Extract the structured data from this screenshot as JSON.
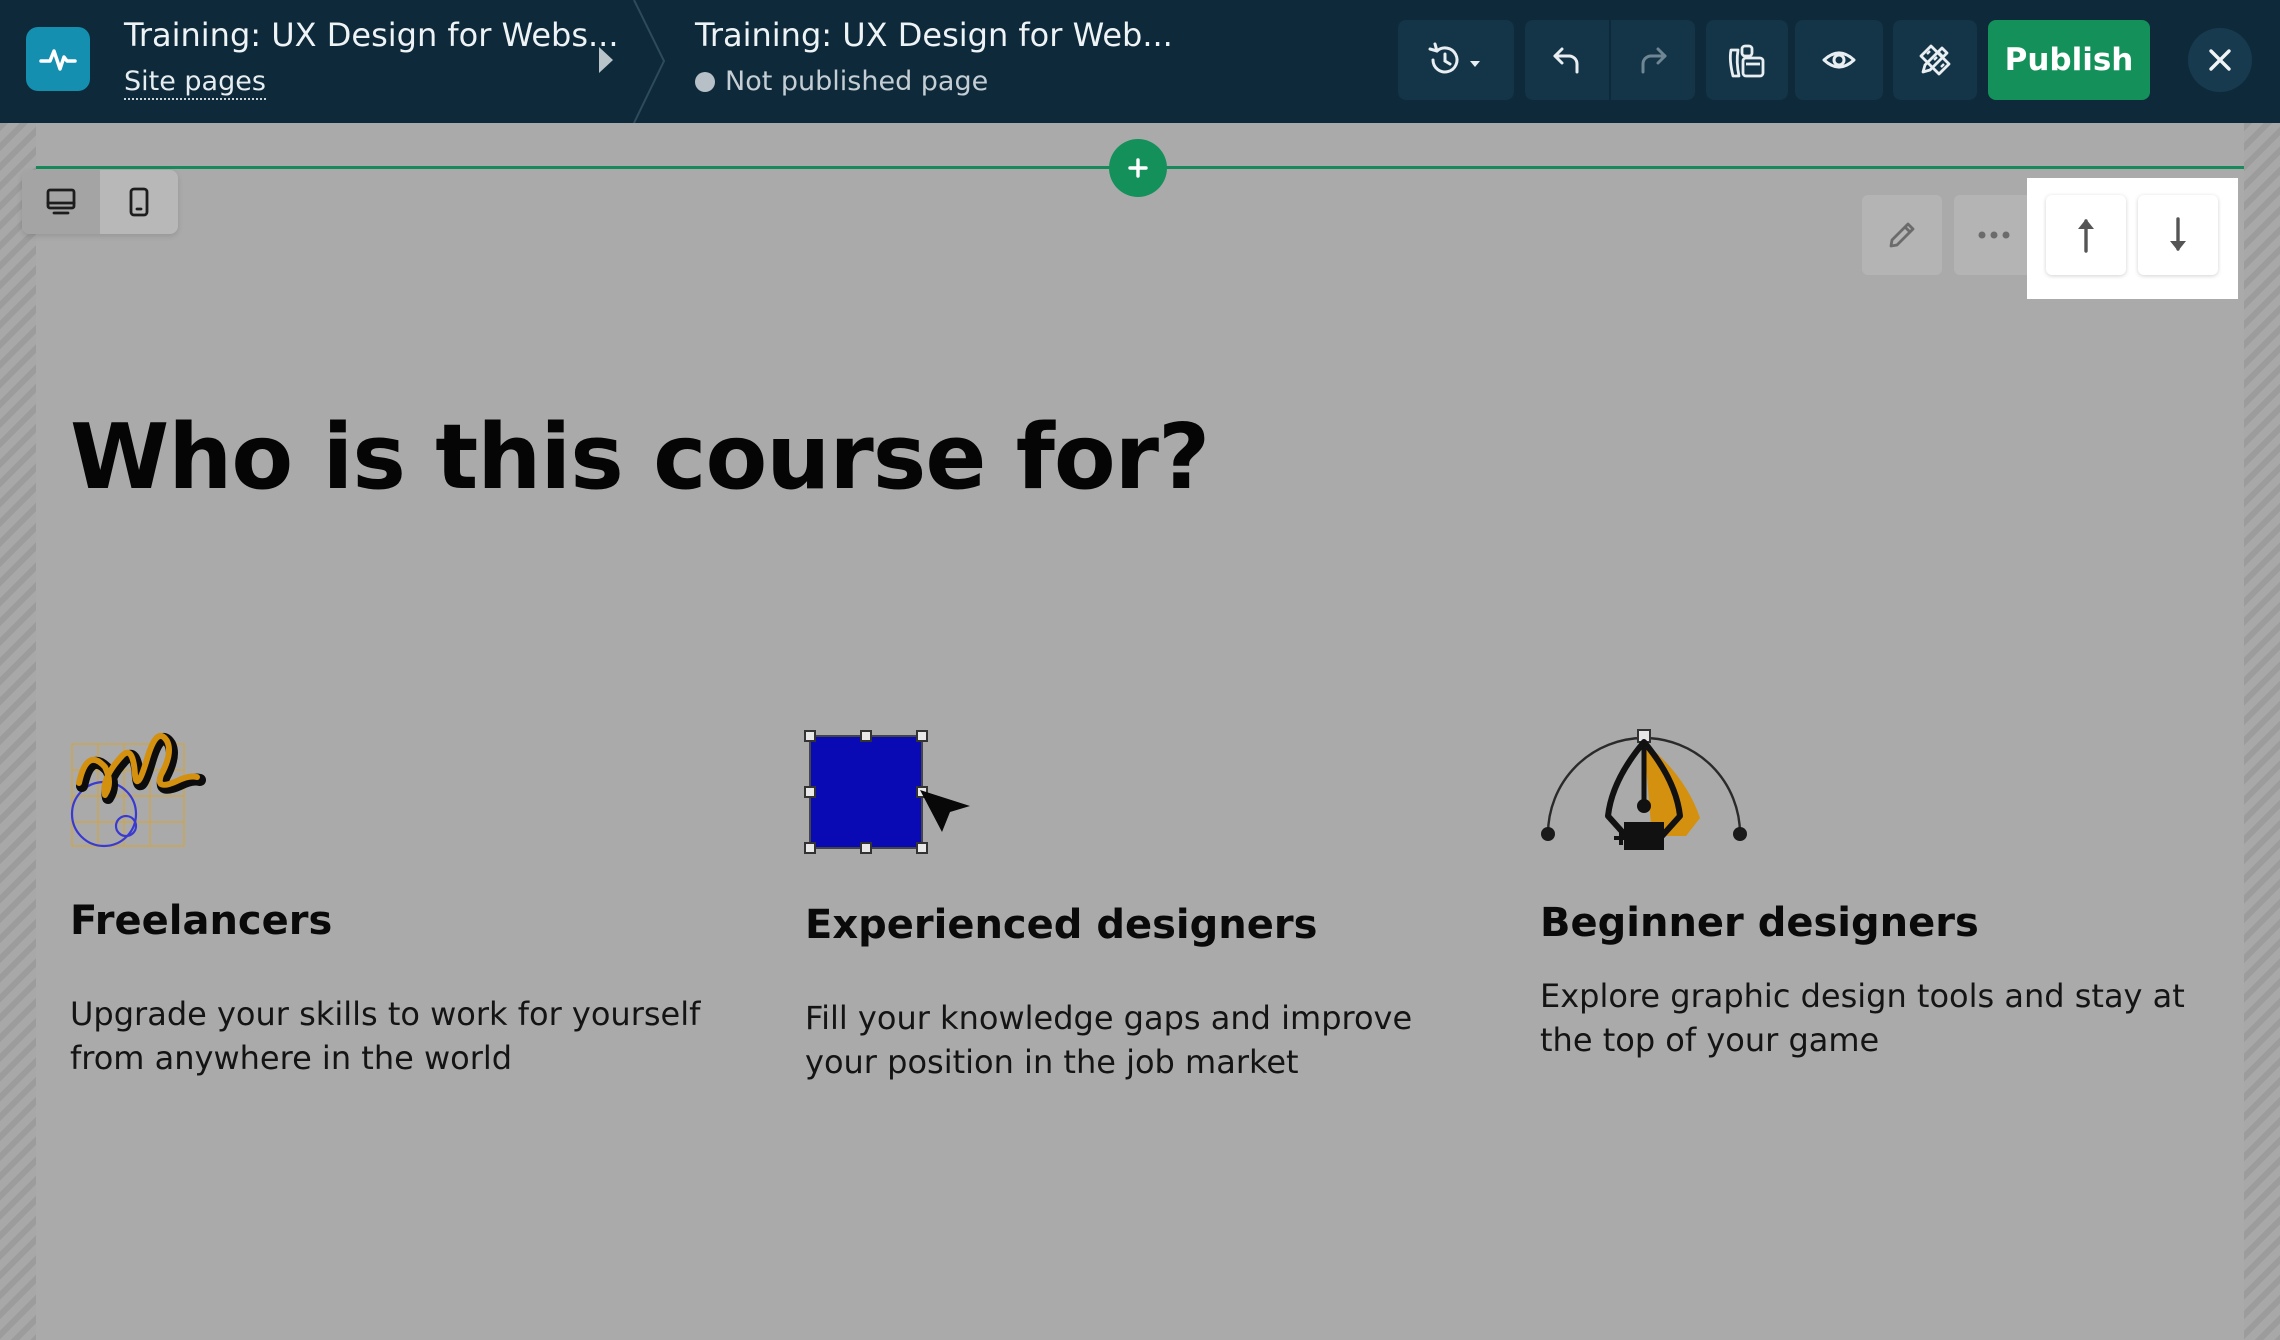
{
  "topbar": {
    "site_title": "Training: UX Design for Webs...",
    "site_pages_label": "Site pages",
    "page_title": "Training: UX Design for Web...",
    "page_status": "Not published page",
    "publish_label": "Publish"
  },
  "section": {
    "heading": "Who is this course for?",
    "cards": [
      {
        "title": "Freelancers",
        "text": "Upgrade your skills to work for yourself from anywhere in the world",
        "icon": "scribble-grid-icon"
      },
      {
        "title": "Experienced designers",
        "text": "Fill your knowledge gaps and improve your position in the job market",
        "icon": "selected-square-cursor-icon"
      },
      {
        "title": "Beginner designers",
        "text": "Explore graphic design tools and stay at the top of your game",
        "icon": "pen-tool-icon"
      }
    ]
  },
  "colors": {
    "topbar_bg": "#0e2a3a",
    "publish_green": "#14915a",
    "logo_blue": "#148fb0",
    "accent_gold": "#d4900f",
    "square_blue": "#0a0ab4"
  }
}
